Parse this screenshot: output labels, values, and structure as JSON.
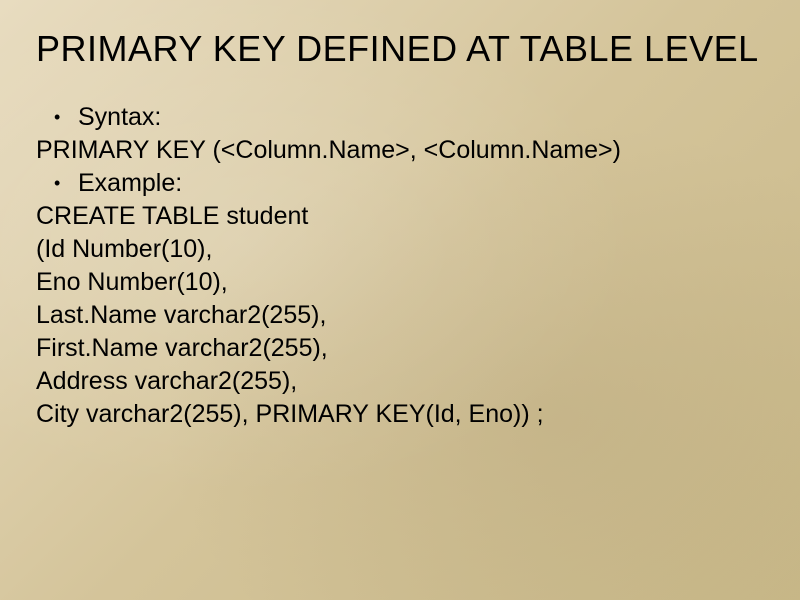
{
  "title": "PRIMARY KEY DEFINED AT TABLE LEVEL",
  "lines": {
    "l1": "Syntax:",
    "l2": "PRIMARY KEY (<Column.Name>, <Column.Name>)",
    "l3": "Example:",
    "l4": "CREATE TABLE student",
    "l5": "(Id Number(10),",
    "l6": "Eno Number(10),",
    "l7": "Last.Name varchar2(255),",
    "l8": "First.Name varchar2(255),",
    "l9": "Address varchar2(255),",
    "l10": "City varchar2(255), PRIMARY KEY(Id, Eno)) ;"
  }
}
